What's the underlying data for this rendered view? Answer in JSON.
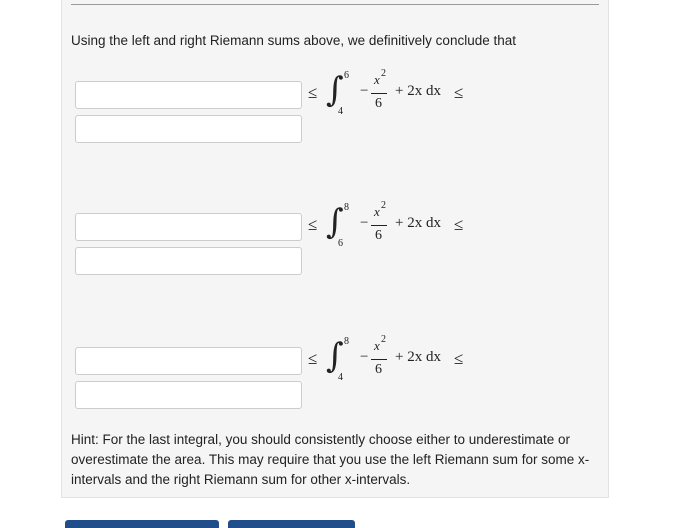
{
  "intro": "Using the left and right Riemann sums above, we definitively conclude that",
  "problems": [
    {
      "lower": "4",
      "upper": "6",
      "num": "x",
      "exp": "2",
      "den": "6",
      "minus": "−",
      "tail": "+ 2x dx",
      "le_left": "≤",
      "le_right": "≤"
    },
    {
      "lower": "6",
      "upper": "8",
      "num": "x",
      "exp": "2",
      "den": "6",
      "minus": "−",
      "tail": "+ 2x dx",
      "le_left": "≤",
      "le_right": "≤"
    },
    {
      "lower": "4",
      "upper": "8",
      "num": "x",
      "exp": "2",
      "den": "6",
      "minus": "−",
      "tail": "+ 2x dx",
      "le_left": "≤",
      "le_right": "≤"
    }
  ],
  "integral_symbol": "∫",
  "inputs": [
    "",
    "",
    "",
    "",
    "",
    ""
  ],
  "hint": "Hint: For the last integral, you should consistently choose either to underestimate or overestimate the area. This may require that you use the left Riemann sum for some x-intervals and the right Riemann sum for other x-intervals.",
  "colors": {
    "panel": "#f5f5f5",
    "button": "#1f4e8a"
  }
}
